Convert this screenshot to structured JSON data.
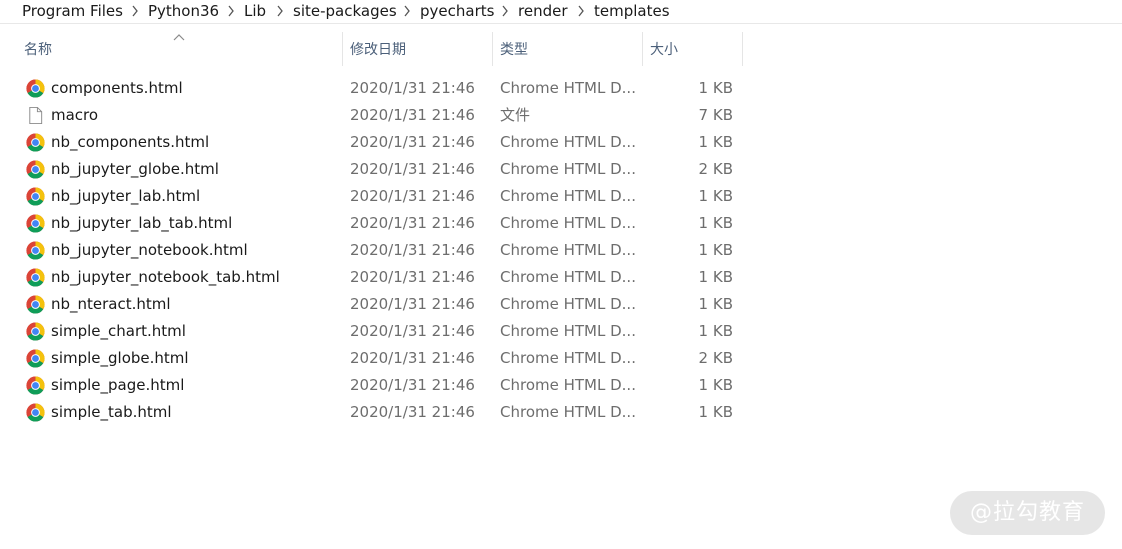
{
  "breadcrumb": [
    "Program Files",
    "Python36",
    "Lib",
    "site-packages",
    "pyecharts",
    "render",
    "templates"
  ],
  "columns": {
    "name": "名称",
    "date": "修改日期",
    "type": "类型",
    "size": "大小"
  },
  "files": [
    {
      "name": "components.html",
      "date": "2020/1/31 21:46",
      "type": "Chrome HTML D...",
      "size": "1 KB",
      "icon": "chrome-icon"
    },
    {
      "name": "macro",
      "date": "2020/1/31 21:46",
      "type": "文件",
      "size": "7 KB",
      "icon": "file-icon"
    },
    {
      "name": "nb_components.html",
      "date": "2020/1/31 21:46",
      "type": "Chrome HTML D...",
      "size": "1 KB",
      "icon": "chrome-icon"
    },
    {
      "name": "nb_jupyter_globe.html",
      "date": "2020/1/31 21:46",
      "type": "Chrome HTML D...",
      "size": "2 KB",
      "icon": "chrome-icon"
    },
    {
      "name": "nb_jupyter_lab.html",
      "date": "2020/1/31 21:46",
      "type": "Chrome HTML D...",
      "size": "1 KB",
      "icon": "chrome-icon"
    },
    {
      "name": "nb_jupyter_lab_tab.html",
      "date": "2020/1/31 21:46",
      "type": "Chrome HTML D...",
      "size": "1 KB",
      "icon": "chrome-icon"
    },
    {
      "name": "nb_jupyter_notebook.html",
      "date": "2020/1/31 21:46",
      "type": "Chrome HTML D...",
      "size": "1 KB",
      "icon": "chrome-icon"
    },
    {
      "name": "nb_jupyter_notebook_tab.html",
      "date": "2020/1/31 21:46",
      "type": "Chrome HTML D...",
      "size": "1 KB",
      "icon": "chrome-icon"
    },
    {
      "name": "nb_nteract.html",
      "date": "2020/1/31 21:46",
      "type": "Chrome HTML D...",
      "size": "1 KB",
      "icon": "chrome-icon"
    },
    {
      "name": "simple_chart.html",
      "date": "2020/1/31 21:46",
      "type": "Chrome HTML D...",
      "size": "1 KB",
      "icon": "chrome-icon"
    },
    {
      "name": "simple_globe.html",
      "date": "2020/1/31 21:46",
      "type": "Chrome HTML D...",
      "size": "2 KB",
      "icon": "chrome-icon"
    },
    {
      "name": "simple_page.html",
      "date": "2020/1/31 21:46",
      "type": "Chrome HTML D...",
      "size": "1 KB",
      "icon": "chrome-icon"
    },
    {
      "name": "simple_tab.html",
      "date": "2020/1/31 21:46",
      "type": "Chrome HTML D...",
      "size": "1 KB",
      "icon": "chrome-icon"
    }
  ],
  "watermark": "@拉勾教育",
  "colors": {
    "header_text": "#4c607a",
    "secondary_text": "#6d6d6d",
    "chrome_red": "#db4437",
    "chrome_yellow": "#f4c20d",
    "chrome_green": "#0f9d58",
    "chrome_blue": "#4285f4"
  }
}
